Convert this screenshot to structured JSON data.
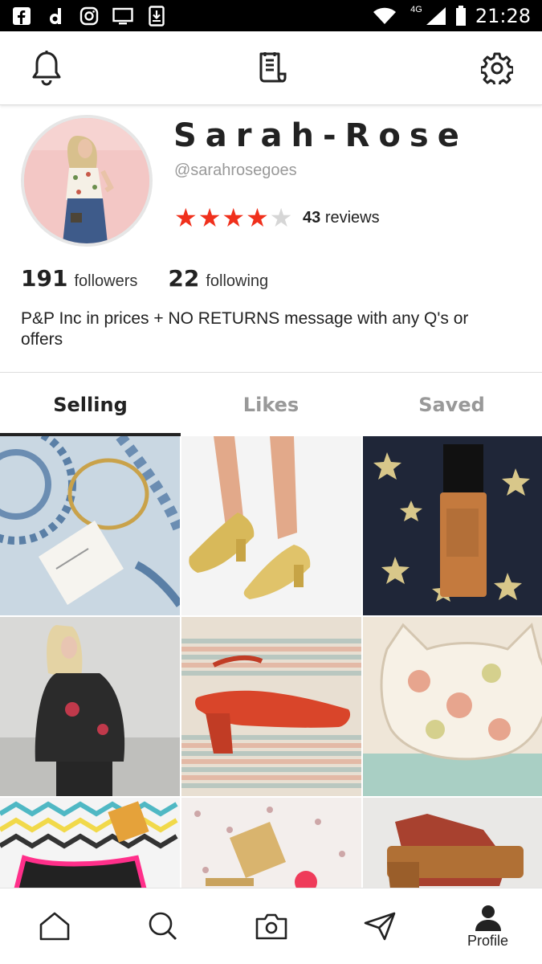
{
  "status_bar": {
    "network": "4G",
    "time": "21:28"
  },
  "profile": {
    "name": "Sarah-Rose",
    "handle": "@sarahrosegoes",
    "rating": 4,
    "rating_max": 5,
    "reviews_count": "43",
    "reviews_label": "reviews",
    "followers_count": "191",
    "followers_label": "followers",
    "following_count": "22",
    "following_label": "following",
    "bio": "P&P Inc in prices + NO RETURNS  message with any Q's or offers"
  },
  "tabs": [
    {
      "label": "Selling",
      "active": true
    },
    {
      "label": "Likes",
      "active": false
    },
    {
      "label": "Saved",
      "active": false
    }
  ],
  "listings": [
    {
      "icon": "bracelet-photo"
    },
    {
      "icon": "gold-heels-photo"
    },
    {
      "icon": "foundation-bottle-photo"
    },
    {
      "icon": "leather-jacket-photo"
    },
    {
      "icon": "red-shoe-photo"
    },
    {
      "icon": "cat-purse-photo"
    },
    {
      "icon": "bikini-photo"
    },
    {
      "icon": "ysl-compact-photo"
    },
    {
      "icon": "wooden-clog-photo"
    }
  ],
  "bottom_nav": {
    "profile_label": "Profile"
  },
  "colors": {
    "star_filled": "#f0301c",
    "star_empty": "#d6d6d6",
    "text_dark": "#222222",
    "text_muted": "#999999"
  }
}
